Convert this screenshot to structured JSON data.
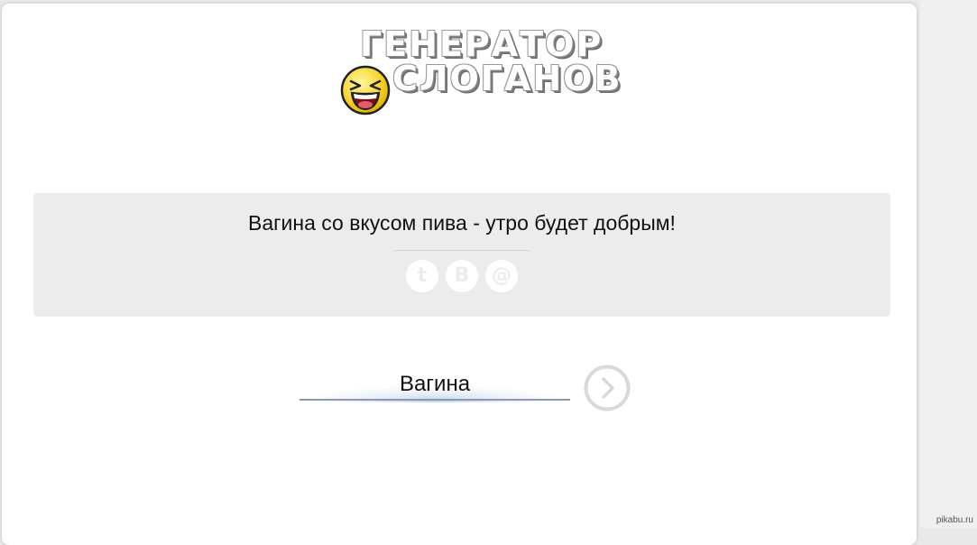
{
  "logo": {
    "line1": "ГЕНЕРАТОР",
    "line2": "СЛОГАНОВ"
  },
  "slogan": {
    "text": "Вагина со вкусом пива - утро будет добрым!"
  },
  "share": {
    "twitter_glyph": "t",
    "vk_glyph": "B",
    "email_glyph": "@",
    "icons": [
      "twitter-icon",
      "vk-icon",
      "email-icon"
    ]
  },
  "input": {
    "value": "Вагина"
  },
  "watermark": {
    "text": "pikabu.ru"
  },
  "colors": {
    "page_background": "#ffffff",
    "slogan_box": "#ececec",
    "button_circle": "#d9d9d9"
  }
}
